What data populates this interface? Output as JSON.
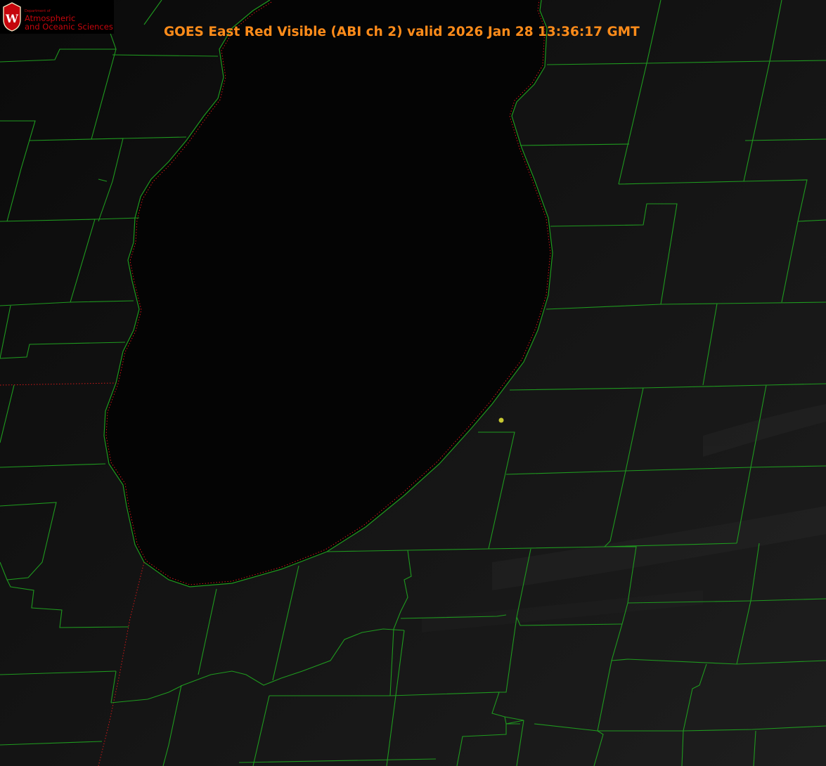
{
  "header": {
    "title": "GOES East Red Visible (ABI ch 2) valid 2026 Jan 28 13:36:17 GMT"
  },
  "logo": {
    "department": "Department of",
    "line1": "Atmospheric",
    "line2": "and Oceanic Sciences",
    "seal_letter": "W"
  },
  "colors": {
    "title": "#ff8c1a",
    "county_lines": "#1f9a1f",
    "shoreline_dots": "#d01818",
    "station_marker": "#c8c832",
    "logo_red": "#c5050c"
  }
}
